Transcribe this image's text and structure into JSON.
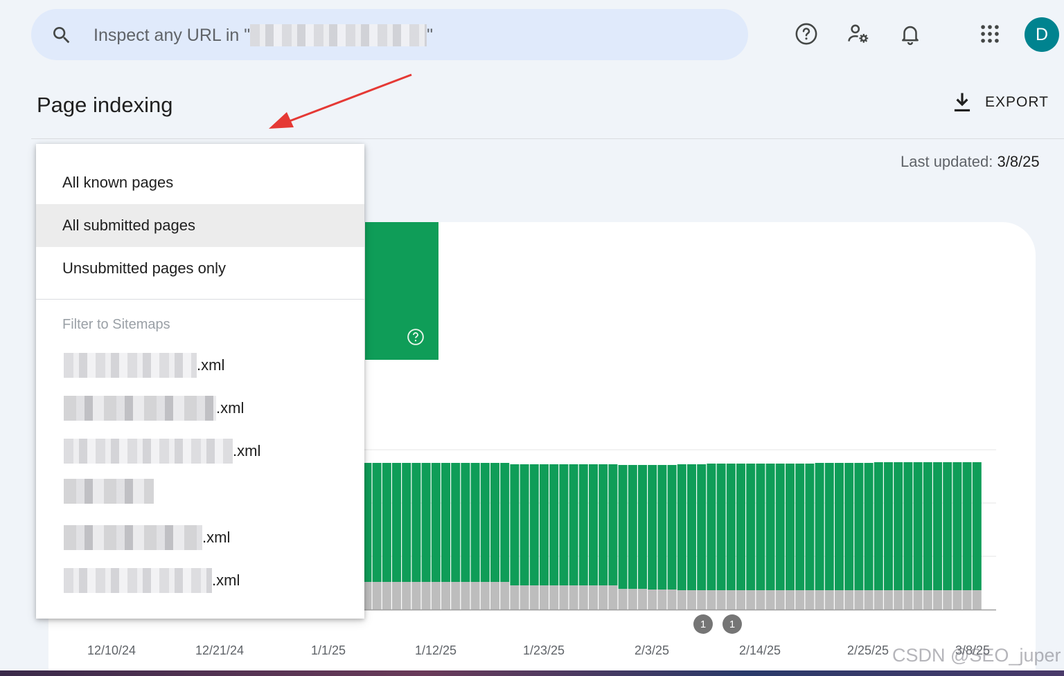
{
  "search": {
    "placeholder_prefix": "Inspect any URL in \"",
    "placeholder_suffix": "\""
  },
  "header_icons": [
    "help-icon",
    "manage-users-icon",
    "notifications-icon",
    "apps-grid-icon"
  ],
  "avatar": {
    "initial": "D",
    "color": "#00838f"
  },
  "page": {
    "title": "Page indexing",
    "export_label": "EXPORT",
    "last_updated_label": "Last updated:",
    "last_updated_value": "3/8/25"
  },
  "dropdown": {
    "options": [
      {
        "label": "All known pages",
        "selected": false
      },
      {
        "label": "All submitted pages",
        "selected": true
      },
      {
        "label": "Unsubmitted pages only",
        "selected": false
      }
    ],
    "sitemaps_header": "Filter to Sitemaps",
    "sitemaps": [
      {
        "suffix": ".xml"
      },
      {
        "suffix": ".xml"
      },
      {
        "suffix": ".xml"
      },
      {
        "suffix": ""
      },
      {
        "suffix": ".xml"
      },
      {
        "suffix": ".xml"
      }
    ]
  },
  "colors": {
    "indexed": "#0f9d58",
    "not_indexed": "#bdbdbd",
    "accent_arrow": "#e53935"
  },
  "chart_data": {
    "type": "bar",
    "stacked": true,
    "x_tick_labels": [
      "12/10/24",
      "12/21/24",
      "1/1/25",
      "1/12/25",
      "1/23/25",
      "2/3/25",
      "2/14/25",
      "2/25/25",
      "3/8/25"
    ],
    "annotations": [
      "1",
      "1"
    ],
    "series": [
      {
        "color": "#bdbdbd",
        "values": [
          40,
          40,
          40,
          40,
          40,
          40,
          40,
          40,
          42,
          42,
          42,
          40,
          40,
          40,
          40,
          40,
          40,
          40,
          40,
          40,
          40,
          40,
          40,
          40,
          40,
          40,
          40,
          40,
          40,
          35,
          35,
          35,
          35,
          35,
          35,
          35,
          35,
          35,
          35,
          35,
          30,
          30,
          30,
          29,
          29,
          29,
          28,
          28,
          28,
          28,
          28,
          28,
          28,
          28,
          28,
          28,
          28,
          28,
          28,
          28,
          28,
          28,
          28,
          28,
          28,
          28,
          28,
          28,
          28,
          28,
          28,
          28,
          28,
          28,
          28,
          28,
          28
        ]
      },
      {
        "color": "#0f9d58",
        "values": [
          171,
          171,
          171,
          171,
          171,
          171,
          171,
          171,
          170,
          170,
          170,
          172,
          172,
          172,
          172,
          172,
          172,
          172,
          172,
          172,
          172,
          172,
          172,
          172,
          172,
          172,
          172,
          172,
          172,
          175,
          175,
          175,
          175,
          175,
          175,
          175,
          175,
          175,
          175,
          175,
          179,
          179,
          179,
          180,
          180,
          180,
          182,
          182,
          182,
          183,
          183,
          183,
          183,
          183,
          183,
          183,
          183,
          183,
          183,
          183,
          184,
          184,
          184,
          184,
          184,
          184,
          185,
          185,
          185,
          185,
          185,
          185,
          185,
          185,
          185,
          185,
          185
        ]
      }
    ],
    "grid": true
  },
  "watermark": "CSDN @SEO_juper"
}
